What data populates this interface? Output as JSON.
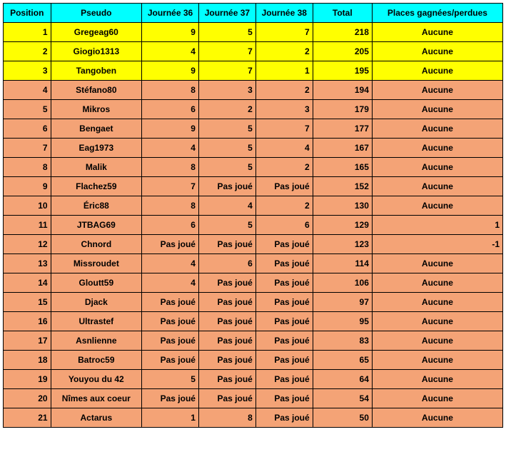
{
  "headers": {
    "position": "Position",
    "pseudo": "Pseudo",
    "j36": "Journée 36",
    "j37": "Journée 37",
    "j38": "Journée 38",
    "total": "Total",
    "places": "Places gagnées/perdues"
  },
  "rows": [
    {
      "position": "1",
      "pseudo": "Gregeag60",
      "j36": "9",
      "j37": "5",
      "j38": "7",
      "total": "218",
      "places": "Aucune",
      "top": true,
      "placesNum": false
    },
    {
      "position": "2",
      "pseudo": "Giogio1313",
      "j36": "4",
      "j37": "7",
      "j38": "2",
      "total": "205",
      "places": "Aucune",
      "top": true,
      "placesNum": false
    },
    {
      "position": "3",
      "pseudo": "Tangoben",
      "j36": "9",
      "j37": "7",
      "j38": "1",
      "total": "195",
      "places": "Aucune",
      "top": true,
      "placesNum": false
    },
    {
      "position": "4",
      "pseudo": "Stéfano80",
      "j36": "8",
      "j37": "3",
      "j38": "2",
      "total": "194",
      "places": "Aucune",
      "top": false,
      "placesNum": false
    },
    {
      "position": "5",
      "pseudo": "Mikros",
      "j36": "6",
      "j37": "2",
      "j38": "3",
      "total": "179",
      "places": "Aucune",
      "top": false,
      "placesNum": false
    },
    {
      "position": "6",
      "pseudo": "Bengaet",
      "j36": "9",
      "j37": "5",
      "j38": "7",
      "total": "177",
      "places": "Aucune",
      "top": false,
      "placesNum": false
    },
    {
      "position": "7",
      "pseudo": "Eag1973",
      "j36": "4",
      "j37": "5",
      "j38": "4",
      "total": "167",
      "places": "Aucune",
      "top": false,
      "placesNum": false
    },
    {
      "position": "8",
      "pseudo": "Malik",
      "j36": "8",
      "j37": "5",
      "j38": "2",
      "total": "165",
      "places": "Aucune",
      "top": false,
      "placesNum": false
    },
    {
      "position": "9",
      "pseudo": "Flachez59",
      "j36": "7",
      "j37": "Pas joué",
      "j38": "Pas joué",
      "total": "152",
      "places": "Aucune",
      "top": false,
      "placesNum": false
    },
    {
      "position": "10",
      "pseudo": "Éric88",
      "j36": "8",
      "j37": "4",
      "j38": "2",
      "total": "130",
      "places": "Aucune",
      "top": false,
      "placesNum": false
    },
    {
      "position": "11",
      "pseudo": "JTBAG69",
      "j36": "6",
      "j37": "5",
      "j38": "6",
      "total": "129",
      "places": "1",
      "top": false,
      "placesNum": true
    },
    {
      "position": "12",
      "pseudo": "Chnord",
      "j36": "Pas joué",
      "j37": "Pas joué",
      "j38": "Pas joué",
      "total": "123",
      "places": "-1",
      "top": false,
      "placesNum": true
    },
    {
      "position": "13",
      "pseudo": "Missroudet",
      "j36": "4",
      "j37": "6",
      "j38": "Pas joué",
      "total": "114",
      "places": "Aucune",
      "top": false,
      "placesNum": false
    },
    {
      "position": "14",
      "pseudo": "Gloutt59",
      "j36": "4",
      "j37": "Pas joué",
      "j38": "Pas joué",
      "total": "106",
      "places": "Aucune",
      "top": false,
      "placesNum": false
    },
    {
      "position": "15",
      "pseudo": "Djack",
      "j36": "Pas joué",
      "j37": "Pas joué",
      "j38": "Pas joué",
      "total": "97",
      "places": "Aucune",
      "top": false,
      "placesNum": false
    },
    {
      "position": "16",
      "pseudo": "Ultrastef",
      "j36": "Pas joué",
      "j37": "Pas joué",
      "j38": "Pas joué",
      "total": "95",
      "places": "Aucune",
      "top": false,
      "placesNum": false
    },
    {
      "position": "17",
      "pseudo": "Asnlienne",
      "j36": "Pas joué",
      "j37": "Pas joué",
      "j38": "Pas joué",
      "total": "83",
      "places": "Aucune",
      "top": false,
      "placesNum": false
    },
    {
      "position": "18",
      "pseudo": "Batroc59",
      "j36": "Pas joué",
      "j37": "Pas joué",
      "j38": "Pas joué",
      "total": "65",
      "places": "Aucune",
      "top": false,
      "placesNum": false
    },
    {
      "position": "19",
      "pseudo": "Youyou du 42",
      "j36": "5",
      "j37": "Pas joué",
      "j38": "Pas joué",
      "total": "64",
      "places": "Aucune",
      "top": false,
      "placesNum": false
    },
    {
      "position": "20",
      "pseudo": "Nîmes aux coeur",
      "j36": "Pas joué",
      "j37": "Pas joué",
      "j38": "Pas joué",
      "total": "54",
      "places": "Aucune",
      "top": false,
      "placesNum": false
    },
    {
      "position": "21",
      "pseudo": "Actarus",
      "j36": "1",
      "j37": "8",
      "j38": "Pas joué",
      "total": "50",
      "places": "Aucune",
      "top": false,
      "placesNum": false
    }
  ]
}
